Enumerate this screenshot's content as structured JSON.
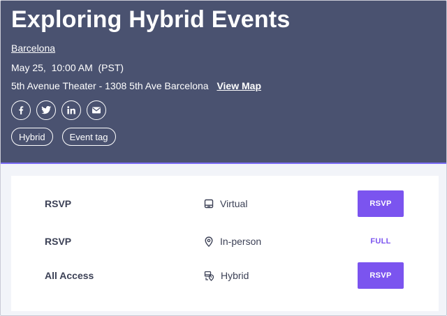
{
  "event": {
    "title": "Exploring Hybrid Events",
    "city": "Barcelona",
    "datetime": "May 25,  10:00 AM  (PST)",
    "venue": "5th Avenue Theater - 1308 5th Ave Barcelona",
    "view_map_label": "View Map"
  },
  "social_icons": [
    "facebook-icon",
    "twitter-icon",
    "linkedin-icon",
    "email-icon"
  ],
  "tags": [
    "Hybrid",
    "Event tag"
  ],
  "tickets": [
    {
      "name": "RSVP",
      "type": "Virtual",
      "type_icon": "laptop-icon",
      "action": "RSVP"
    },
    {
      "name": "RSVP",
      "type": "In-person",
      "type_icon": "location-pin-icon",
      "status": "FULL"
    },
    {
      "name": "All Access",
      "type": "Hybrid",
      "type_icon": "hybrid-icon",
      "action": "RSVP"
    }
  ],
  "colors": {
    "hero_bg": "#4a5270",
    "accent": "#7b54ef",
    "page_bg": "#f2f4f9",
    "text_dark": "#3c4156"
  }
}
